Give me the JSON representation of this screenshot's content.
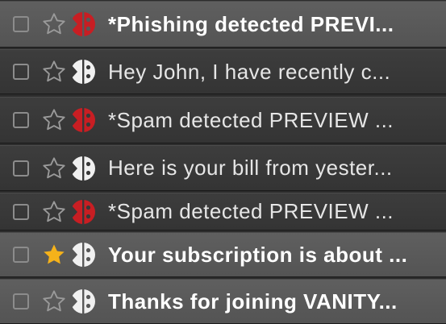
{
  "colors": {
    "danger_icon": "#c81e23",
    "safe_icon": "#f0f0f0",
    "star_on": "#f5b21a",
    "star_off": "#9a9a9a"
  },
  "emails": [
    {
      "subject": "*Phishing detected PREVI...",
      "unread": true,
      "starred": false,
      "status": "danger"
    },
    {
      "subject": "Hey John, I have recently c...",
      "unread": false,
      "starred": false,
      "status": "safe"
    },
    {
      "subject": "*Spam detected  PREVIEW ...",
      "unread": false,
      "starred": false,
      "status": "danger"
    },
    {
      "subject": "Here is your bill from yester...",
      "unread": false,
      "starred": false,
      "status": "safe"
    },
    {
      "subject": "*Spam detected  PREVIEW ...",
      "unread": false,
      "starred": false,
      "status": "danger"
    },
    {
      "subject": "Your subscription is about ...",
      "unread": true,
      "starred": true,
      "status": "safe"
    },
    {
      "subject": "Thanks for joining VANITY...",
      "unread": true,
      "starred": false,
      "status": "safe"
    }
  ]
}
